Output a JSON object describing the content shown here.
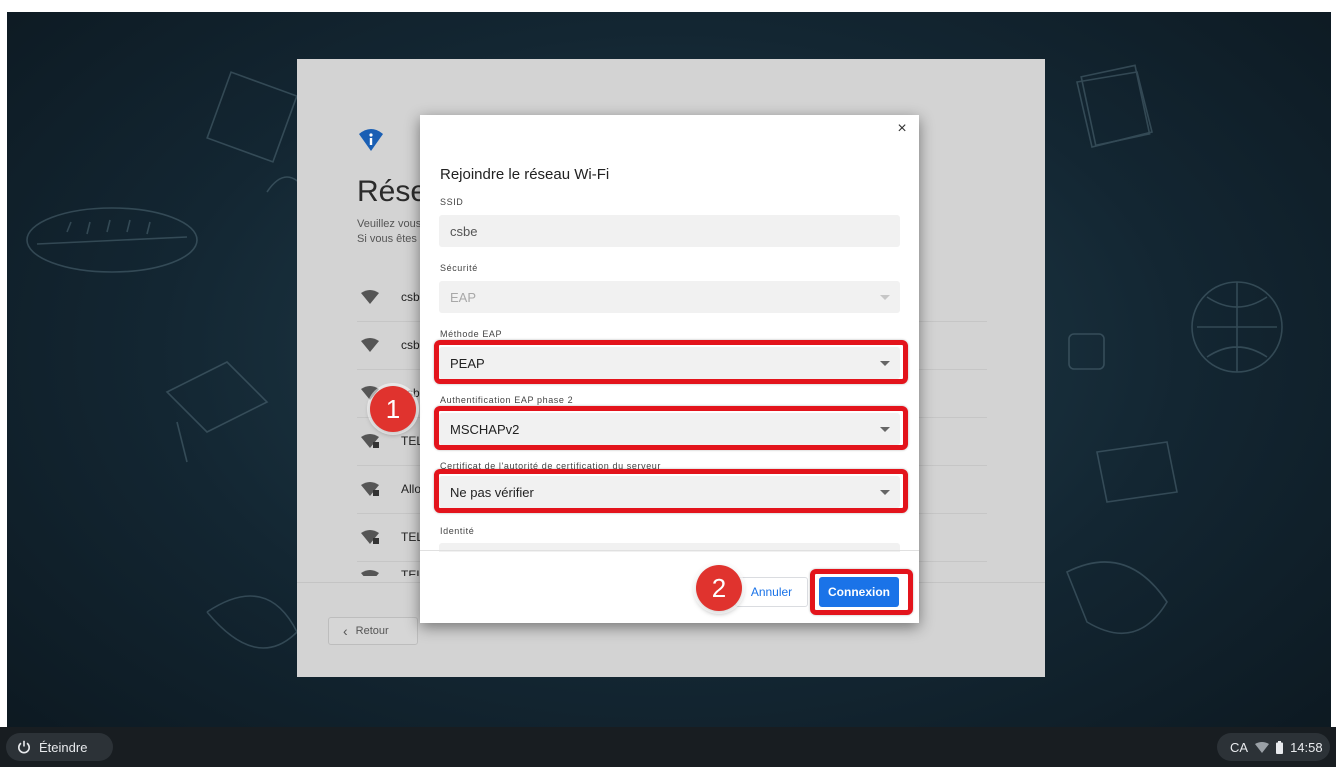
{
  "oobe": {
    "title": "Réseau",
    "subtitle_line1": "Veuillez vous",
    "subtitle_line2": "Si vous êtes",
    "networks": [
      {
        "label": "csbe",
        "locked": false
      },
      {
        "label": "csbe",
        "locked": false
      },
      {
        "label": "csbe",
        "locked": false
      },
      {
        "label": "TELUS",
        "locked": true
      },
      {
        "label": "Allo",
        "locked": true
      },
      {
        "label": "TELUS",
        "locked": true
      },
      {
        "label": "TELUS",
        "locked": true
      }
    ],
    "back_label": "Retour"
  },
  "dialog": {
    "close_label": "×",
    "title": "Rejoindre le réseau Wi-Fi",
    "ssid_label": "SSID",
    "ssid_value": "csbe",
    "security_label": "Sécurité",
    "security_value": "EAP",
    "eap_method_label": "Méthode EAP",
    "eap_method_value": "PEAP",
    "phase2_label": "Authentification EAP phase 2",
    "phase2_value": "MSCHAPv2",
    "cert_label": "Certificat de l'autorité de certification du serveur",
    "cert_value": "Ne pas vérifier",
    "identity_label": "Identité",
    "cancel_label": "Annuler",
    "connect_label": "Connexion"
  },
  "annotations": {
    "badge1": "1",
    "badge2": "2",
    "highlight_color": "#e3141c"
  },
  "shelf": {
    "power_label": "Éteindre",
    "lang": "CA",
    "time": "14:58"
  },
  "colors": {
    "accent": "#1a73e8",
    "oobe_icon": "#1a5fb4"
  }
}
